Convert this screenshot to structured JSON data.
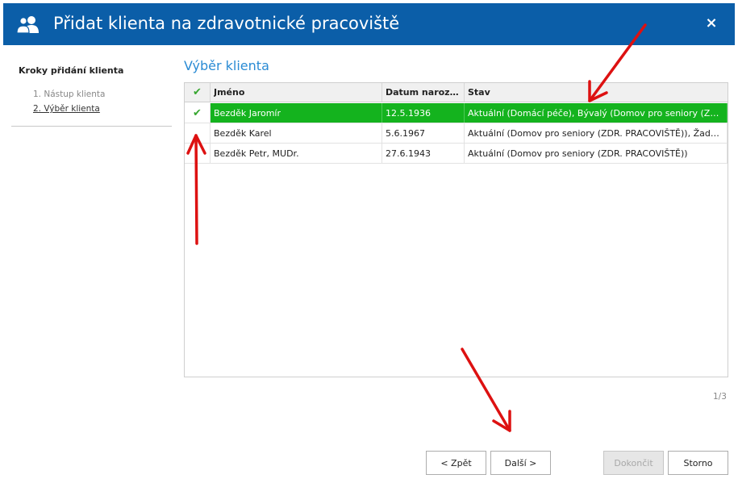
{
  "window": {
    "title": "Přidat klienta na zdravotnické pracoviště",
    "close_glyph": "×"
  },
  "sidebar": {
    "heading": "Kroky přidání klienta",
    "steps": [
      {
        "label": "1. Nástup klienta"
      },
      {
        "label": "2. Výběr klienta"
      }
    ]
  },
  "main": {
    "section_title": "Výběr klienta",
    "table": {
      "columns": [
        "✔",
        "Jméno",
        "Datum narození",
        "Stav"
      ],
      "rows": [
        {
          "checked": "✔",
          "name": "Bezděk Jaromír",
          "birth_date": "12.5.1936",
          "status": "Aktuální (Domácí péče), Bývalý (Domov pro seniory (ZDR. PRACOVIŠTĚ))"
        },
        {
          "checked": "",
          "name": "Bezděk Karel",
          "birth_date": "5.6.1967",
          "status": "Aktuální (Domov pro seniory (ZDR. PRACOVIŠTĚ)), Žadatel (DpS)"
        },
        {
          "checked": "",
          "name": "Bezděk Petr, MUDr.",
          "birth_date": "27.6.1943",
          "status": "Aktuální (Domov pro seniory (ZDR. PRACOVIŠTĚ))"
        }
      ]
    },
    "pager": "1/3"
  },
  "buttons": {
    "back": "< Zpět",
    "next": "Další >",
    "finish": "Dokončit",
    "cancel": "Storno"
  },
  "colors": {
    "titlebar": "#0b5ea8",
    "selected_row": "#14b31e",
    "section_title": "#2a8bd4",
    "annotation_arrow": "#dd1111"
  },
  "icons": {
    "title": "users-icon",
    "close": "close-icon",
    "check": "check-icon"
  }
}
